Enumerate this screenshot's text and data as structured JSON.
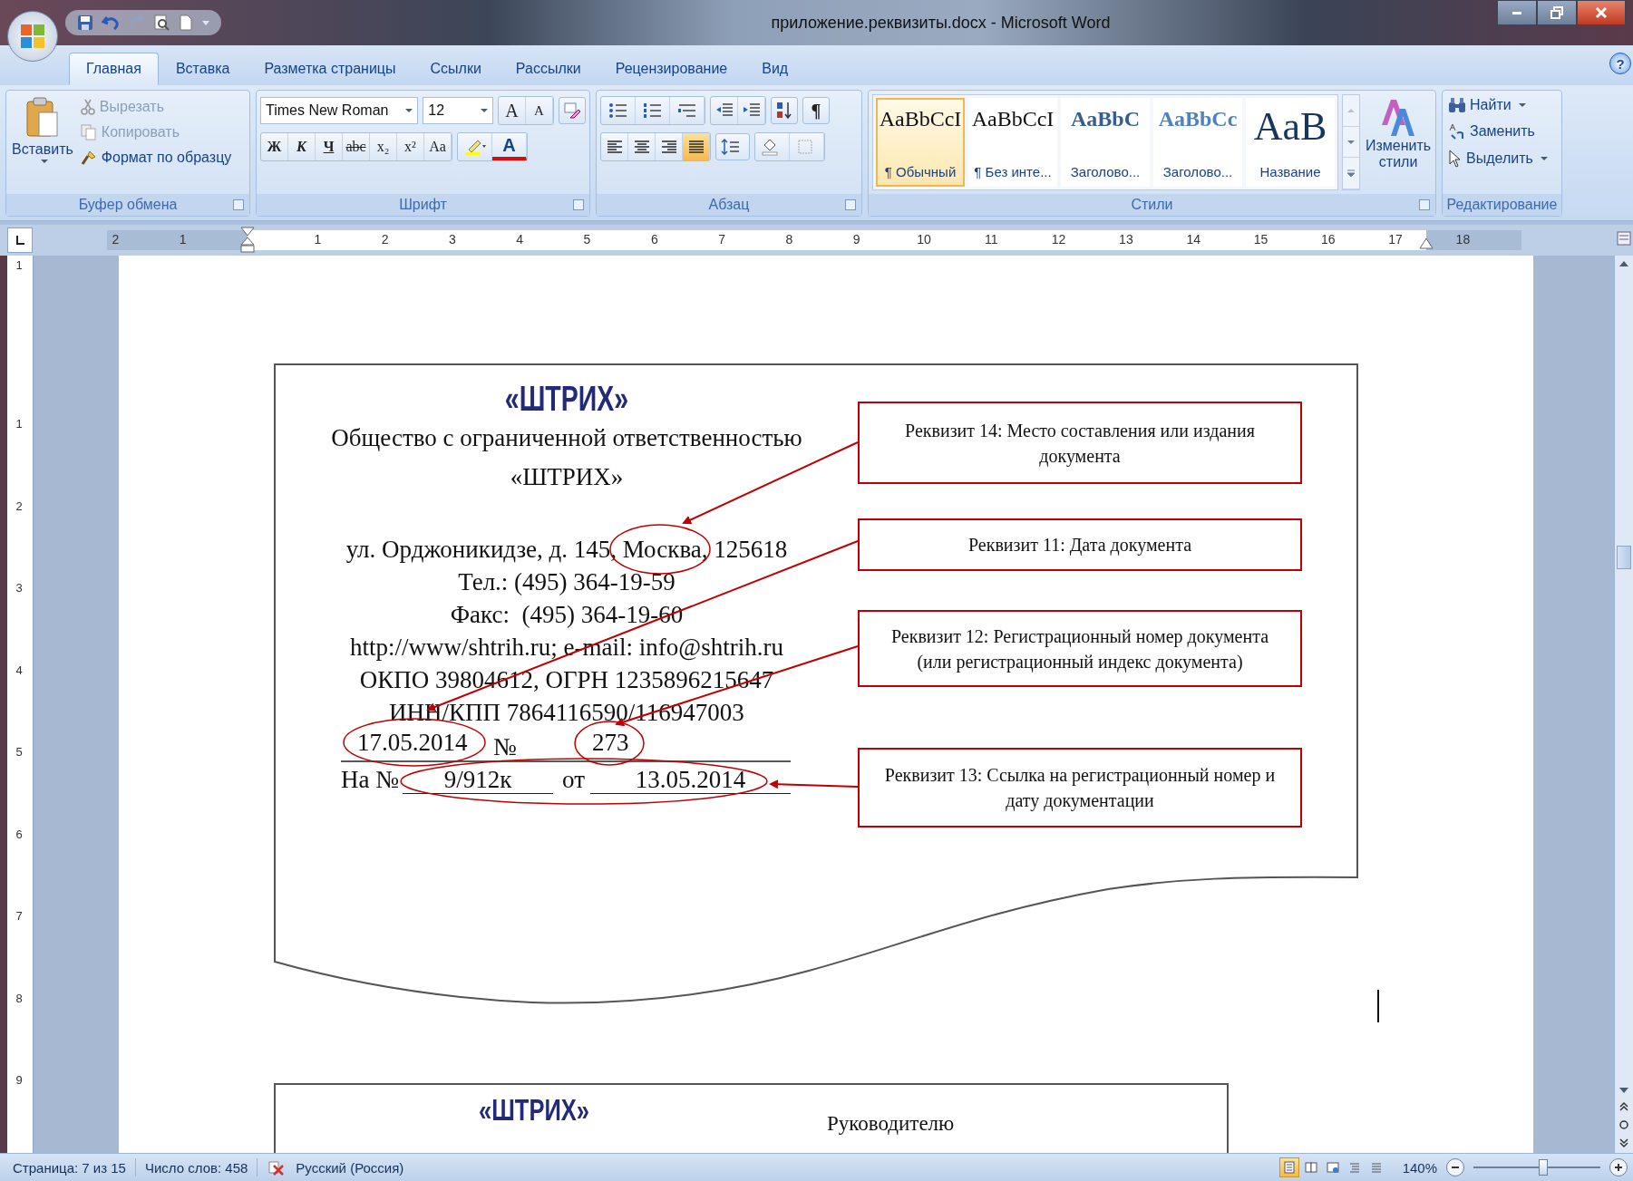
{
  "window": {
    "title": "приложение.реквизиты.docx - Microsoft Word",
    "help": "?"
  },
  "tabs": [
    {
      "label": "Главная",
      "selected": true
    },
    {
      "label": "Вставка",
      "selected": false
    },
    {
      "label": "Разметка страницы",
      "selected": false
    },
    {
      "label": "Ссылки",
      "selected": false
    },
    {
      "label": "Рассылки",
      "selected": false
    },
    {
      "label": "Рецензирование",
      "selected": false
    },
    {
      "label": "Вид",
      "selected": false
    }
  ],
  "clipboard": {
    "paste": "Вставить",
    "label": "Буфер обмена",
    "items": [
      {
        "label": "Вырезать",
        "kind": "cut",
        "disabled": true
      },
      {
        "label": "Копировать",
        "kind": "copy",
        "disabled": true
      },
      {
        "label": "Формат по образцу",
        "kind": "format",
        "disabled": false
      }
    ]
  },
  "font": {
    "family": "Times New Roman",
    "size": "12",
    "label": "Шрифт",
    "buttons": [
      {
        "text": "A",
        "kind": "grow"
      },
      {
        "text": "A",
        "kind": "shrink"
      },
      {
        "text": "Ж",
        "kind": "bold"
      },
      {
        "text": "К",
        "kind": "italic"
      },
      {
        "text": "Ч",
        "kind": "underline"
      },
      {
        "text": "abc",
        "kind": "strike"
      },
      {
        "text": "x₂",
        "kind": "sub"
      },
      {
        "text": "x²",
        "kind": "sup"
      },
      {
        "text": "Aa",
        "kind": "case"
      },
      {
        "text": "A",
        "kind": "color"
      }
    ]
  },
  "paragraph": {
    "label": "Абзац",
    "pilcrow": "¶",
    "align": [
      {
        "kind": "left",
        "selected": false
      },
      {
        "kind": "center",
        "selected": false
      },
      {
        "kind": "right",
        "selected": false
      },
      {
        "kind": "justify",
        "selected": true
      }
    ]
  },
  "styles": {
    "label": "Стили",
    "change": "Изменить стили",
    "items": [
      {
        "sample": "AaBbCcI",
        "name": "¶ Обычный",
        "kind": "normal",
        "selected": true
      },
      {
        "sample": "AaBbCcI",
        "name": "¶ Без инте...",
        "kind": "normal",
        "selected": false
      },
      {
        "sample": "AaBbC",
        "name": "Заголово...",
        "kind": "heading1",
        "selected": false
      },
      {
        "sample": "AaBbCc",
        "name": "Заголово...",
        "kind": "heading2",
        "selected": false
      },
      {
        "sample": "AaB",
        "name": "Название",
        "kind": "title",
        "selected": false
      }
    ]
  },
  "editing": {
    "label": "Редактирование",
    "items": [
      {
        "label": "Найти",
        "kind": "find",
        "dropdown": true
      },
      {
        "label": "Заменить",
        "kind": "replace",
        "dropdown": false
      },
      {
        "label": "Выделить",
        "kind": "select",
        "dropdown": true
      }
    ]
  },
  "ruler": {
    "labels": [
      "2",
      "1",
      "1",
      "2",
      "3",
      "4",
      "5",
      "6",
      "7",
      "8",
      "9",
      "10",
      "11",
      "12",
      "13",
      "14",
      "15",
      "16",
      "17",
      "18"
    ]
  },
  "vertical_ruler": {
    "labels": [
      "1",
      "1",
      "2",
      "3",
      "4",
      "5",
      "6",
      "7",
      "8",
      "9"
    ]
  },
  "figure": {
    "logo": "«ШТРИХ»",
    "lines": [
      "Общество с ограниченной ответственностью",
      "«ШТРИХ»",
      "ул. Орджоникидзе, д. 145, Москва, 125618",
      "Тел.: (495) 364-19-59",
      "Факс:  (495) 364-19-60",
      "http://www/shtrih.ru; e-mail: info@shtrih.ru",
      "ОКПО 39804612, ОГРН 1235896215647",
      "ИНН/КПП 7864116590/116947003"
    ],
    "date": "17.05.2014",
    "number_sign": "№",
    "number": "273",
    "reference_label": "На №",
    "reference_number": "9/912к",
    "reference_from": "от",
    "reference_date": "13.05.2014",
    "callouts": [
      "Реквизит 14: Место составления или издания документа",
      "Реквизит 11: Дата документа",
      "Реквизит 12: Регистрационный номер документа (или регистрационный индекс документа)",
      "Реквизит 13: Ссылка на регистрационный номер и дату документации"
    ]
  },
  "figure_2": {
    "logo": "«ШТРИХ»",
    "recipient": "Руководителю"
  },
  "status_bar": {
    "page": "Страница: 7 из 15",
    "words": "Число слов: 458",
    "language": "Русский (Россия)",
    "zoom": "140%",
    "zoom_slider": {
      "level": 0.55
    }
  }
}
